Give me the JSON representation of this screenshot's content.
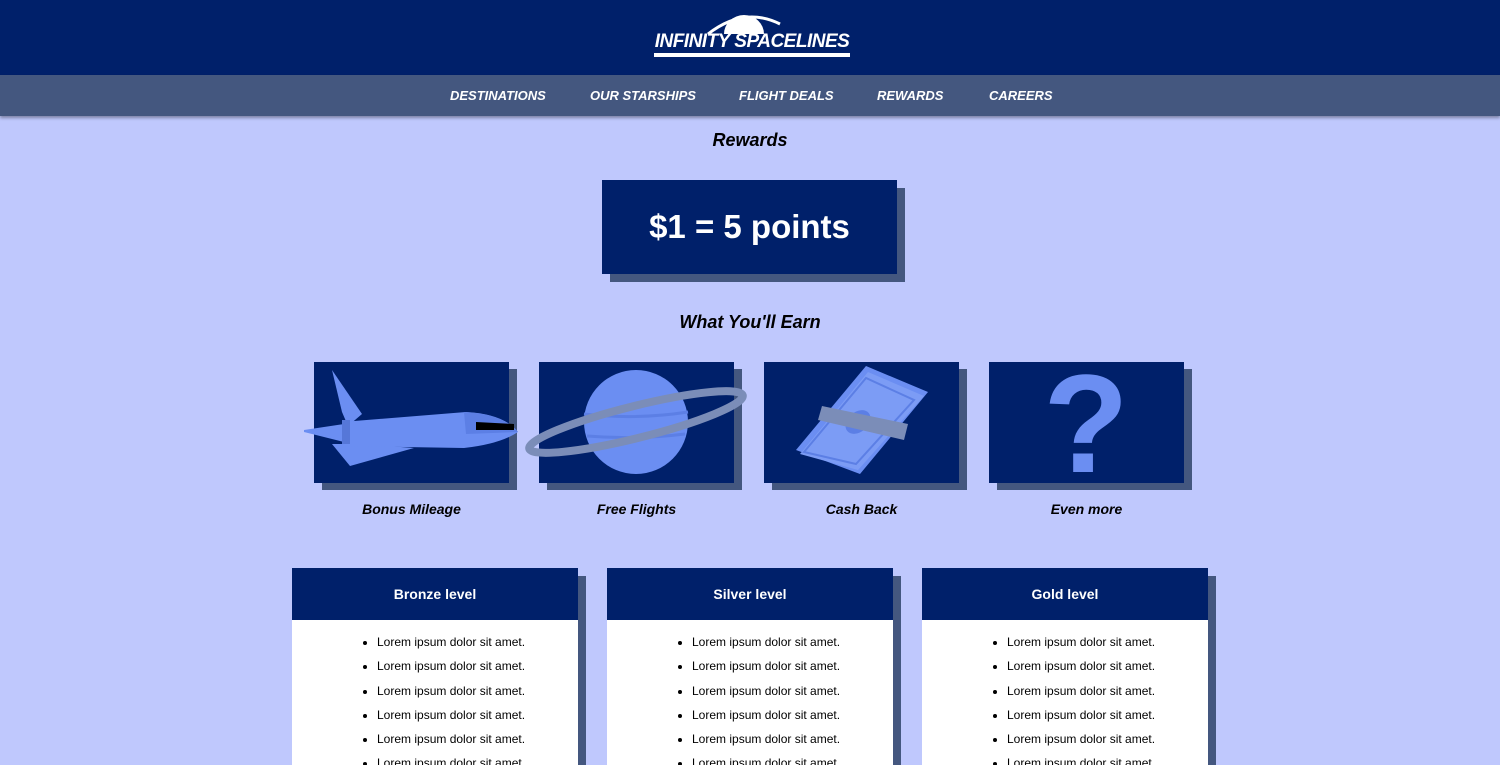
{
  "header": {
    "logo_text": "INFINITY SPACELINES"
  },
  "nav": {
    "items": [
      {
        "label": "DESTINATIONS"
      },
      {
        "label": "OUR STARSHIPS"
      },
      {
        "label": "FLIGHT DEALS"
      },
      {
        "label": "REWARDS"
      },
      {
        "label": "CAREERS"
      }
    ]
  },
  "page": {
    "title": "Rewards",
    "points_rate": "$1 = 5 points",
    "earn_title": "What You'll Earn"
  },
  "earn": {
    "items": [
      {
        "label": "Bonus Mileage",
        "icon": "spaceship-icon"
      },
      {
        "label": "Free Flights",
        "icon": "planet-icon"
      },
      {
        "label": "Cash Back",
        "icon": "cash-stack-icon"
      },
      {
        "label": "Even more",
        "icon": "question-mark-icon"
      }
    ]
  },
  "levels": [
    {
      "title": "Bronze level",
      "items": [
        "Lorem ipsum dolor sit amet.",
        "Lorem ipsum dolor sit amet.",
        "Lorem ipsum dolor sit amet.",
        "Lorem ipsum dolor sit amet.",
        "Lorem ipsum dolor sit amet.",
        "Lorem ipsum dolor sit amet."
      ]
    },
    {
      "title": "Silver level",
      "items": [
        "Lorem ipsum dolor sit amet.",
        "Lorem ipsum dolor sit amet.",
        "Lorem ipsum dolor sit amet.",
        "Lorem ipsum dolor sit amet.",
        "Lorem ipsum dolor sit amet.",
        "Lorem ipsum dolor sit amet."
      ]
    },
    {
      "title": "Gold level",
      "items": [
        "Lorem ipsum dolor sit amet.",
        "Lorem ipsum dolor sit amet.",
        "Lorem ipsum dolor sit amet.",
        "Lorem ipsum dolor sit amet.",
        "Lorem ipsum dolor sit amet.",
        "Lorem ipsum dolor sit amet."
      ]
    }
  ],
  "colors": {
    "brand_navy": "#00206a",
    "nav_slate": "#44577f",
    "background": "#bfc8fd",
    "icon_blue": "#6b8ef2"
  }
}
